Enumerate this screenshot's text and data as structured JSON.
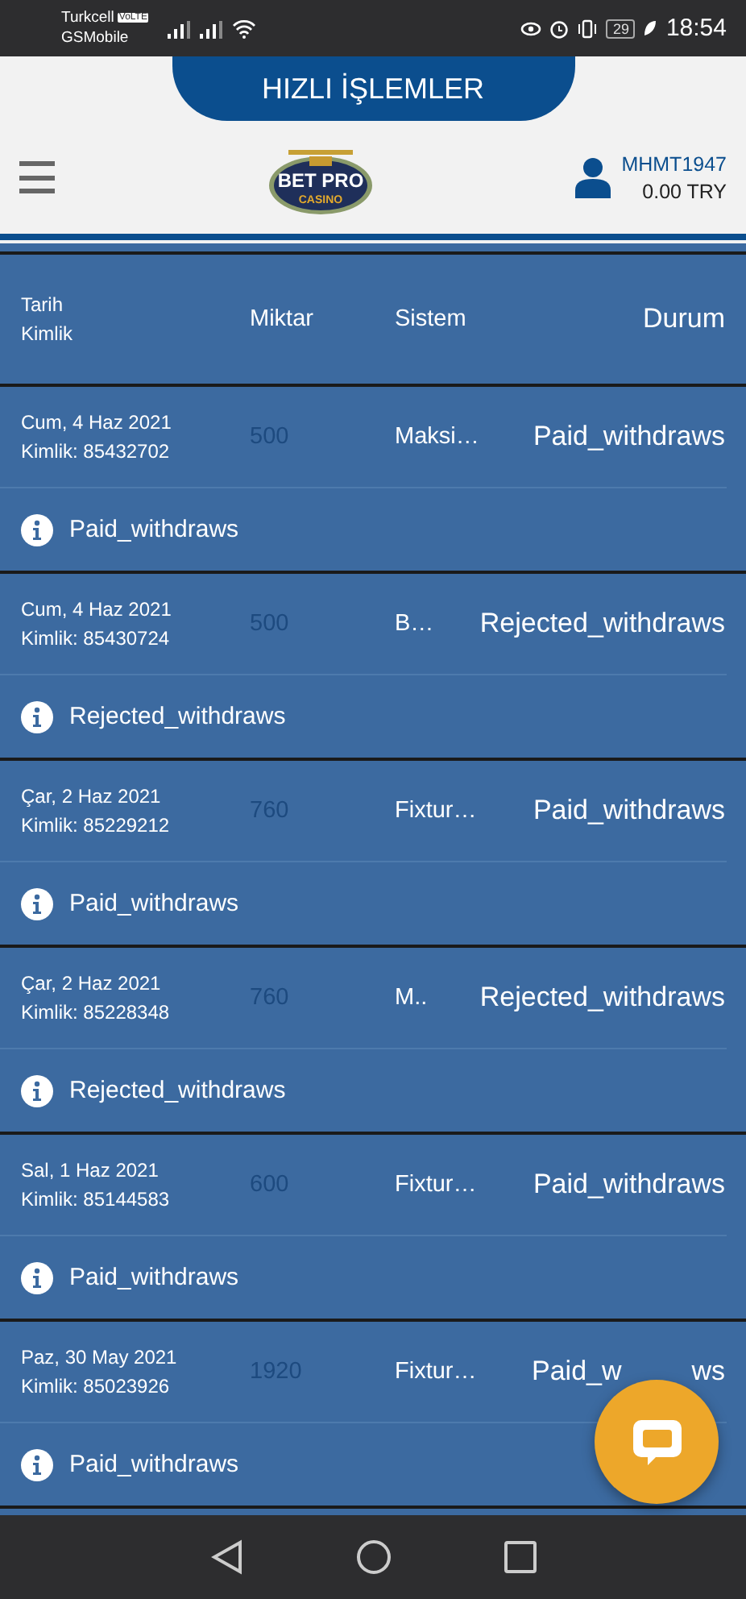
{
  "status_bar": {
    "carrier": "Turkcell",
    "volte": "VoLTE",
    "network": "GSMobile",
    "battery": "29",
    "time": "18:54"
  },
  "quick_tab": {
    "label": "HIZLI İŞLEMLER"
  },
  "header": {
    "logo": {
      "title": "BET PRO",
      "subtitle": "CASINO"
    },
    "username": "MHMT1947",
    "balance": "0.00 TRY"
  },
  "table": {
    "columns": {
      "date": "Tarih",
      "id": "Kimlik",
      "amount": "Miktar",
      "system": "Sistem",
      "status": "Durum"
    },
    "rows": [
      {
        "date": "Cum, 4 Haz 2021",
        "id": "Kimlik: 85432702",
        "amount": "500",
        "system": "Maksi…",
        "status": "Paid_withdraws",
        "note": "Paid_withdraws"
      },
      {
        "date": "Cum, 4 Haz 2021",
        "id": "Kimlik: 85430724",
        "amount": "500",
        "system": "B…",
        "status": "Rejected_withdraws",
        "note": "Rejected_withdraws"
      },
      {
        "date": "Çar, 2 Haz 2021",
        "id": "Kimlik: 85229212",
        "amount": "760",
        "system": "Fixtur…",
        "status": "Paid_withdraws",
        "note": "Paid_withdraws"
      },
      {
        "date": "Çar, 2 Haz 2021",
        "id": "Kimlik: 85228348",
        "amount": "760",
        "system": "M..",
        "status": "Rejected_withdraws",
        "note": "Rejected_withdraws"
      },
      {
        "date": "Sal, 1 Haz 2021",
        "id": "Kimlik: 85144583",
        "amount": "600",
        "system": "Fixtur…",
        "status": "Paid_withdraws",
        "note": "Paid_withdraws"
      },
      {
        "date": "Paz, 30 May 2021",
        "id": "Kimlik: 85023926",
        "amount": "1920",
        "system": "Fixtur…",
        "status": "Paid_w",
        "status_tail": "ws",
        "note": "Paid_withdraws"
      }
    ]
  }
}
